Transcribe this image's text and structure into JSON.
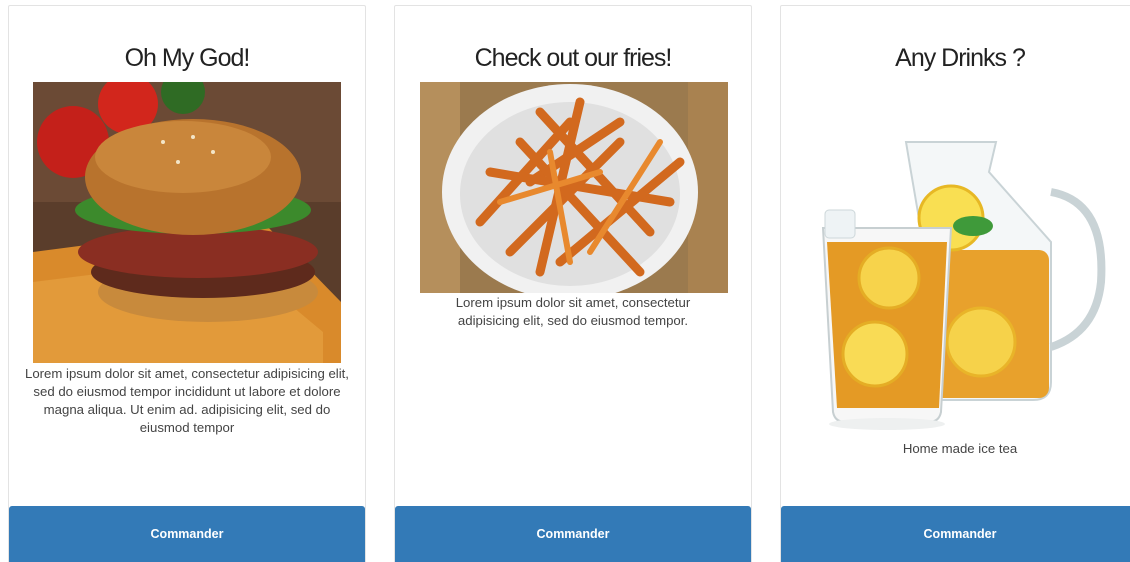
{
  "cards": [
    {
      "title": "Oh My God!",
      "image_subject": "burger",
      "description": "Lorem ipsum dolor sit amet, consectetur adipisicing elit, sed do eiusmod tempor incididunt ut labore et dolore magna aliqua. Ut enim ad. adipisicing elit, sed do eiusmod tempor",
      "button_label": "Commander"
    },
    {
      "title": "Check out our fries!",
      "image_subject": "fries",
      "description": "Lorem ipsum dolor sit amet, consectetur adipisicing elit, sed do eiusmod tempor.",
      "button_label": "Commander"
    },
    {
      "title": "Any Drinks ?",
      "image_subject": "iced-tea",
      "description": "Home made ice tea",
      "button_label": "Commander"
    }
  ],
  "colors": {
    "button_bg": "#337ab7",
    "button_text": "#ffffff",
    "card_border": "#e3e3e3"
  }
}
